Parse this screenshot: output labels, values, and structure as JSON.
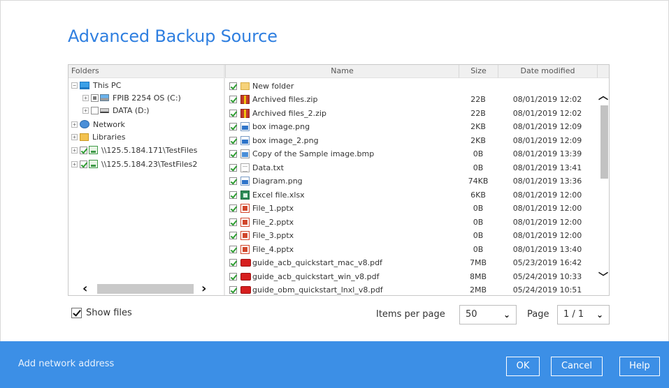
{
  "dialog": {
    "title": "Advanced Backup Source"
  },
  "columns": {
    "folders": "Folders",
    "name": "Name",
    "size": "Size",
    "date": "Date modified"
  },
  "tree": {
    "this_pc": "This PC",
    "drive_c": "FPIB 2254 OS (C:)",
    "drive_d": "DATA (D:)",
    "network": "Network",
    "libraries": "Libraries",
    "share1": "\\\\125.5.184.171\\TestFiles",
    "share2": "\\\\125.5.184.23\\TestFiles2"
  },
  "files": [
    {
      "name": "New folder",
      "size": "",
      "date": "",
      "icon": "folder"
    },
    {
      "name": "Archived files.zip",
      "size": "22B",
      "date": "08/01/2019 12:02",
      "icon": "zip"
    },
    {
      "name": "Archived files_2.zip",
      "size": "22B",
      "date": "08/01/2019 12:02",
      "icon": "zip"
    },
    {
      "name": "box image.png",
      "size": "2KB",
      "date": "08/01/2019 12:09",
      "icon": "img"
    },
    {
      "name": "box image_2.png",
      "size": "2KB",
      "date": "08/01/2019 12:09",
      "icon": "img"
    },
    {
      "name": "Copy of the Sample image.bmp",
      "size": "0B",
      "date": "08/01/2019 13:39",
      "icon": "bmp"
    },
    {
      "name": "Data.txt",
      "size": "0B",
      "date": "08/01/2019 13:41",
      "icon": "txt"
    },
    {
      "name": "Diagram.png",
      "size": "74KB",
      "date": "08/01/2019 13:36",
      "icon": "img"
    },
    {
      "name": "Excel file.xlsx",
      "size": "6KB",
      "date": "08/01/2019 12:00",
      "icon": "xlsx"
    },
    {
      "name": "File_1.pptx",
      "size": "0B",
      "date": "08/01/2019 12:00",
      "icon": "pptx"
    },
    {
      "name": "File_2.pptx",
      "size": "0B",
      "date": "08/01/2019 12:00",
      "icon": "pptx"
    },
    {
      "name": "File_3.pptx",
      "size": "0B",
      "date": "08/01/2019 12:00",
      "icon": "pptx"
    },
    {
      "name": "File_4.pptx",
      "size": "0B",
      "date": "08/01/2019 13:40",
      "icon": "pptx"
    },
    {
      "name": "guide_acb_quickstart_mac_v8.pdf",
      "size": "7MB",
      "date": "05/23/2019 16:42",
      "icon": "pdf"
    },
    {
      "name": "guide_acb_quickstart_win_v8.pdf",
      "size": "8MB",
      "date": "05/24/2019 10:33",
      "icon": "pdf"
    },
    {
      "name": "guide_obm_quickstart_lnxl_v8.pdf",
      "size": "2MB",
      "date": "05/24/2019 10:51",
      "icon": "pdf"
    }
  ],
  "controls": {
    "show_files": "Show files",
    "items_per_page_label": "Items per page",
    "items_per_page_value": "50",
    "page_label": "Page",
    "page_value": "1 / 1"
  },
  "footer": {
    "add_network": "Add network address",
    "ok": "OK",
    "cancel": "Cancel",
    "help": "Help"
  },
  "colors": {
    "accent": "#3c8fe6",
    "title": "#2f7fe0",
    "check": "#2e9c32"
  }
}
